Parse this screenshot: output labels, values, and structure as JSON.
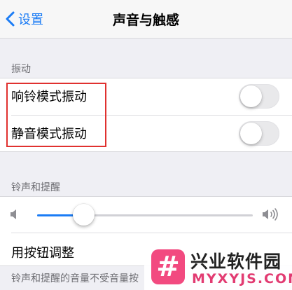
{
  "nav": {
    "back_label": "设置",
    "title": "声音与触感"
  },
  "vibration": {
    "header": "振动",
    "items": [
      {
        "label": "响铃模式振动",
        "on": false
      },
      {
        "label": "静音模式振动",
        "on": false
      }
    ]
  },
  "ringer": {
    "header": "铃声和提醒",
    "volume_level": 0.215,
    "adjust_label": "用按钮调整",
    "footer": "铃声和提醒的音量不受音量按"
  },
  "watermark": {
    "cn": "兴业软件园",
    "en": "MYXYJS.COM",
    "logo": "#"
  },
  "colors": {
    "accent": "#1b7cf5",
    "highlight": "#e0312f",
    "background": "#efeff4"
  },
  "icons": [
    "chevron-left-icon",
    "speaker-low-icon",
    "speaker-high-icon"
  ]
}
